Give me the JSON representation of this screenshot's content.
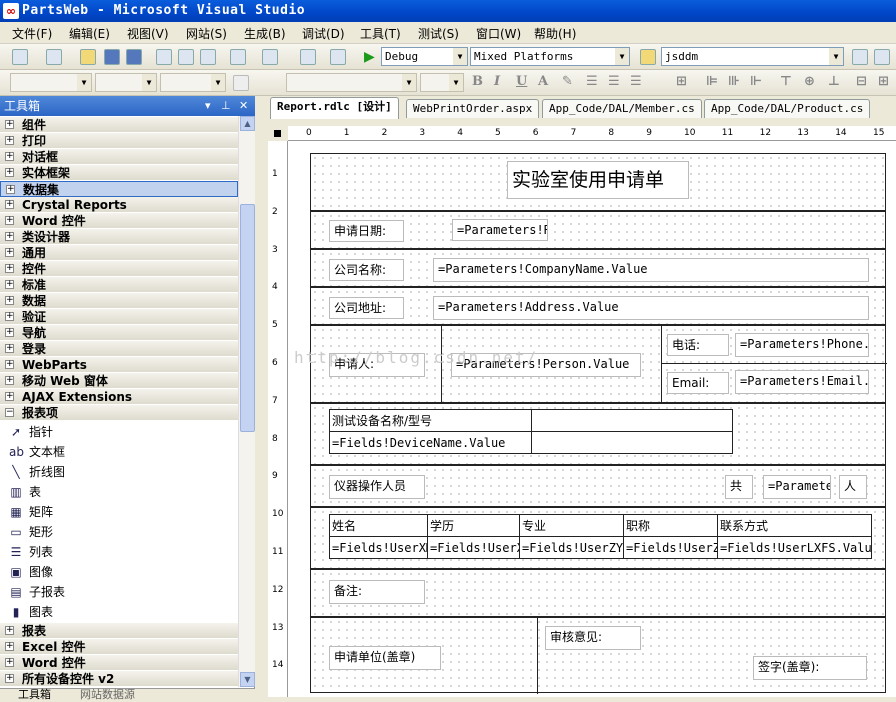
{
  "window": {
    "title": "PartsWeb - Microsoft Visual Studio"
  },
  "menu": [
    "文件(F)",
    "编辑(E)",
    "视图(V)",
    "网站(S)",
    "生成(B)",
    "调试(D)",
    "工具(T)",
    "测试(S)",
    "窗口(W)",
    "帮助(H)"
  ],
  "toolbar": {
    "config": "Debug",
    "platform": "Mixed Platforms",
    "find": "jsddm"
  },
  "toolbox": {
    "title": "工具箱",
    "categories_top": [
      "组件",
      "打印",
      "对话框",
      "实体框架",
      "数据集",
      "Crystal Reports",
      "Word 控件",
      "类设计器",
      "通用",
      "控件",
      "标准",
      "数据",
      "验证",
      "导航",
      "登录",
      "WebParts",
      "移动 Web 窗体",
      "AJAX Extensions",
      "报表项"
    ],
    "selected": "数据集",
    "items": [
      {
        "label": "指针",
        "icon": "pointer-icon",
        "glyph": "➚"
      },
      {
        "label": "文本框",
        "icon": "textbox-icon",
        "glyph": "ab"
      },
      {
        "label": "折线图",
        "icon": "line-icon",
        "glyph": "╲"
      },
      {
        "label": "表",
        "icon": "table-icon",
        "glyph": "▥"
      },
      {
        "label": "矩阵",
        "icon": "matrix-icon",
        "glyph": "▦"
      },
      {
        "label": "矩形",
        "icon": "rectangle-icon",
        "glyph": "▭"
      },
      {
        "label": "列表",
        "icon": "list-icon",
        "glyph": "☰"
      },
      {
        "label": "图像",
        "icon": "image-icon",
        "glyph": "▣"
      },
      {
        "label": "子报表",
        "icon": "subreport-icon",
        "glyph": "▤"
      },
      {
        "label": "图表",
        "icon": "chart-icon",
        "glyph": "▮"
      }
    ],
    "categories_bottom": [
      "报表",
      "Excel 控件",
      "Word 控件",
      "所有设备控件 v2"
    ],
    "bottom_tabs": [
      "工具箱",
      "网站数据源"
    ]
  },
  "tabs": [
    {
      "label": "Report.rdlc [设计]",
      "active": true
    },
    {
      "label": "WebPrintOrder.aspx",
      "active": false
    },
    {
      "label": "App_Code/DAL/Member.cs",
      "active": false
    },
    {
      "label": "App_Code/DAL/Product.cs",
      "active": false
    }
  ],
  "ruler": {
    "h": [
      "0",
      "1",
      "2",
      "3",
      "4",
      "5",
      "6",
      "7",
      "8",
      "9",
      "10",
      "11",
      "12",
      "13",
      "14",
      "15"
    ],
    "v": [
      "1",
      "2",
      "3",
      "4",
      "5",
      "6",
      "7",
      "8",
      "9",
      "10",
      "11",
      "12",
      "13",
      "14"
    ]
  },
  "report": {
    "title": "实验室使用申请单",
    "date_label": "申请日期:",
    "date_value": "=Parameters!R",
    "company_label": "公司名称:",
    "company_value": "=Parameters!CompanyName.Value",
    "address_label": "公司地址:",
    "address_value": "=Parameters!Address.Value",
    "applicant_label": "申请人:",
    "applicant_value": "=Parameters!Person.Value",
    "phone_label": "电话:",
    "phone_value": "=Parameters!Phone.",
    "email_label": "Email:",
    "email_value": "=Parameters!Email.",
    "device_header": "测试设备名称/型号",
    "device_value": "=Fields!DeviceName.Value",
    "operators_label": "仪器操作人员",
    "total_label": "共",
    "total_value": "=Paramete",
    "unit": "人",
    "staff_headers": [
      "姓名",
      "学历",
      "专业",
      "职称",
      "联系方式"
    ],
    "staff_values": [
      "=Fields!UserXM",
      "=Fields!UserXL",
      "=Fields!UserZY",
      "=Fields!UserZC",
      "=Fields!UserLXFS.Value"
    ],
    "remark_label": "备注:",
    "unit_label": "申请单位(盖章)",
    "review_label": "审核意见:",
    "sign_label": "签字(盖章):",
    "watermark": "http://blog.csdn.net/"
  }
}
